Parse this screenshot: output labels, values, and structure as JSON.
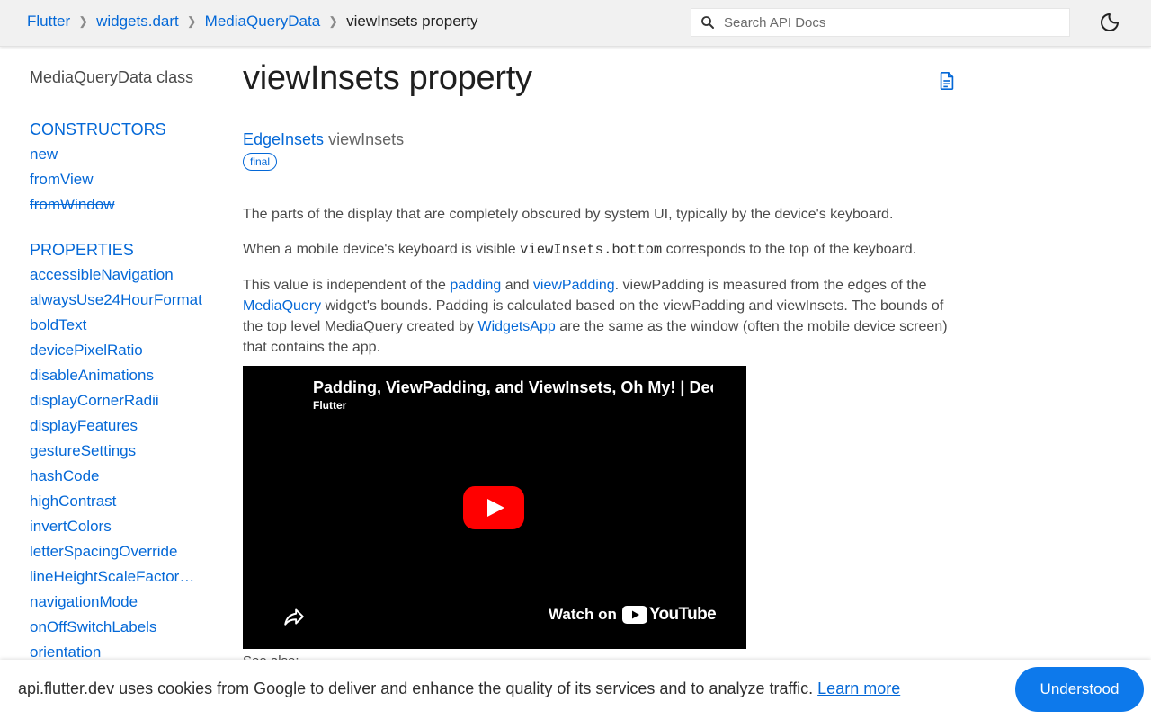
{
  "header": {
    "breadcrumbs": [
      {
        "label": "Flutter"
      },
      {
        "label": "widgets.dart"
      },
      {
        "label": "MediaQueryData"
      }
    ],
    "current": "viewInsets property",
    "search_placeholder": "Search API Docs",
    "theme_icon": "moon-icon"
  },
  "sidebar": {
    "class_title": "MediaQueryData class",
    "constructors_label": "CONSTRUCTORS",
    "constructors": [
      {
        "label": "new",
        "deprecated": false
      },
      {
        "label": "fromView",
        "deprecated": false
      },
      {
        "label": "fromWindow",
        "deprecated": true
      }
    ],
    "properties_label": "PROPERTIES",
    "properties": [
      "accessibleNavigation",
      "alwaysUse24HourFormat",
      "boldText",
      "devicePixelRatio",
      "disableAnimations",
      "displayCornerRadii",
      "displayFeatures",
      "gestureSettings",
      "hashCode",
      "highContrast",
      "invertColors",
      "letterSpacingOverride",
      "lineHeightScaleFactorOverride",
      "navigationMode",
      "onOffSwitchLabels",
      "orientation"
    ]
  },
  "main": {
    "title": "viewInsets property",
    "signature_type": "EdgeInsets",
    "signature_name": "viewInsets",
    "badge": "final",
    "p1": "The parts of the display that are completely obscured by system UI, typically by the device's keyboard.",
    "p2_before": "When a mobile device's keyboard is visible ",
    "p2_code": "viewInsets.bottom",
    "p2_after": " corresponds to the top of the keyboard.",
    "p3_a": "This value is independent of the ",
    "p3_link1": "padding",
    "p3_b": " and ",
    "p3_link2": "viewPadding",
    "p3_c": ". viewPadding is measured from the edges of the ",
    "p3_link3": "MediaQuery",
    "p3_d": " widget's bounds. Padding is calculated based on the viewPadding and viewInsets. The bounds of the top level MediaQuery created by ",
    "p3_link4": "WidgetsApp",
    "p3_e": " are the same as the window (often the mobile device screen) that contains the app.",
    "video": {
      "title": "Padding, ViewPadding, and ViewInsets, Oh My! | Decoding Flutter",
      "channel": "Flutter",
      "watch_on": "Watch on",
      "youtube": "YouTube"
    },
    "below_video": "See also:"
  },
  "cookie": {
    "text": "api.flutter.dev uses cookies from Google to deliver and enhance the quality of its services and to analyze traffic.",
    "link": "Learn more",
    "button": "Understood"
  }
}
